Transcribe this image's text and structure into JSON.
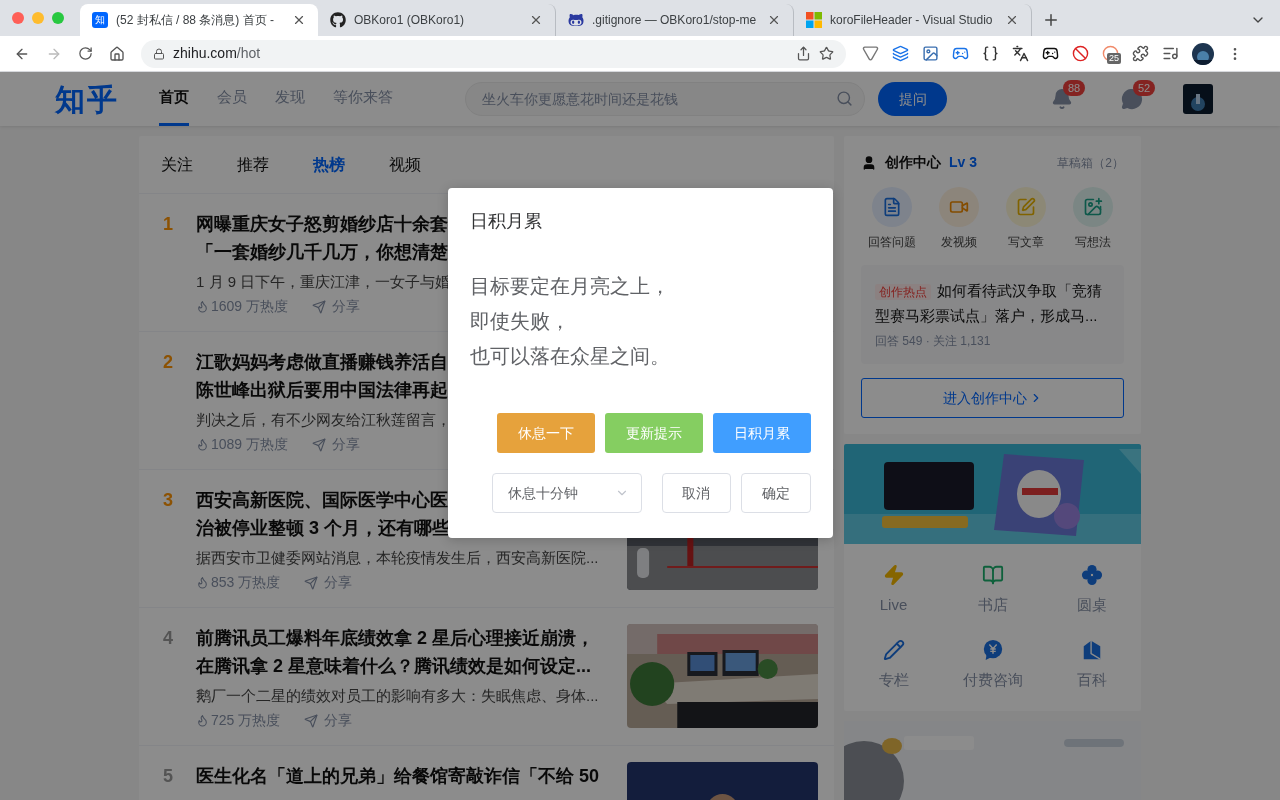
{
  "browser": {
    "tabs": [
      {
        "favicon": "知",
        "title": "(52 封私信 / 88 条消息) 首页 -",
        "selected": true
      },
      {
        "title": "OBKoro1 (OBKoro1)",
        "selected": false
      },
      {
        "title": ".gitignore — OBKoro1/stop-me",
        "selected": false
      },
      {
        "title": "koroFileHeader - Visual Studio",
        "selected": false
      }
    ],
    "url": {
      "host": "zhihu.com",
      "path": "/hot"
    },
    "extension_badge": "25"
  },
  "header": {
    "logo": "知乎",
    "nav": [
      {
        "label": "首页",
        "selected": true
      },
      {
        "label": "会员",
        "selected": false
      },
      {
        "label": "发现",
        "selected": false
      },
      {
        "label": "等你来答",
        "selected": false
      }
    ],
    "search": {
      "placeholder": "坐火车你更愿意花时间还是花钱"
    },
    "ask_button": "提问",
    "notification_badge": "88",
    "message_badge": "52"
  },
  "feed": {
    "tabs": [
      {
        "label": "关注",
        "selected": false
      },
      {
        "label": "推荐",
        "selected": false
      },
      {
        "label": "热榜",
        "selected": true
      },
      {
        "label": "视频",
        "selected": false
      }
    ],
    "items": [
      {
        "rank": "1",
        "hot": true,
        "title_lines": [
          "网曝重庆女子怒剪婚纱店十余套",
          "「一套婚纱几千几万，你想清楚"
        ],
        "excerpt": "1 月 9 日下午，重庆江津，一女子与婚",
        "heat": "1609 万热度",
        "share": "分享"
      },
      {
        "rank": "2",
        "hot": true,
        "title_lines": [
          "江歌妈妈考虑做直播赚钱养活自",
          "陈世峰出狱后要用中国法律再起"
        ],
        "excerpt": "判决之后，有不少网友给江秋莲留言，",
        "heat": "1089 万热度",
        "share": "分享"
      },
      {
        "rank": "3",
        "hot": true,
        "title_lines": [
          "西安高新医院、国际医学中心医",
          "治被停业整顿 3 个月，还有哪些"
        ],
        "excerpt": "据西安市卫健委网站消息，本轮疫情发生后，西安高新医院...",
        "heat": "853 万热度",
        "share": "分享",
        "thumbnail": {
          "kind": "picture"
        }
      },
      {
        "rank": "4",
        "hot": false,
        "title_lines": [
          "前腾讯员工爆料年底绩效拿 2 星后心理接近崩溃，",
          "在腾讯拿 2 星意味着什么？腾讯绩效是如何设定..."
        ],
        "excerpt": "鹅厂一个二星的绩效对员工的影响有多大：失眠焦虑、身体...",
        "heat": "725 万热度",
        "share": "分享",
        "thumbnail": {
          "kind": "picture"
        }
      },
      {
        "rank": "5",
        "hot": false,
        "title_lines": [
          "医生化名「道上的兄弟」给餐馆寄敲诈信「不给 50"
        ],
        "thumbnail": {
          "kind": "picture"
        }
      }
    ]
  },
  "creator": {
    "title": "创作中心",
    "level": "Lv 3",
    "drafts": "草稿箱（2）",
    "actions": [
      {
        "label": "回答问题"
      },
      {
        "label": "发视频"
      },
      {
        "label": "写文章"
      },
      {
        "label": "写想法"
      }
    ],
    "hot_topic": {
      "tag": "创作热点",
      "text": "如何看待武汉争取「竞猜型赛马彩票试点」落户，形成马...",
      "meta": "回答 549 · 关注 1,131"
    },
    "enter_button": "进入创作中心"
  },
  "promo": {
    "banner": {
      "kind": "picture"
    },
    "shortcuts": [
      {
        "label": "Live"
      },
      {
        "label": "书店"
      },
      {
        "label": "圆桌"
      },
      {
        "label": "专栏"
      },
      {
        "label": "付费咨询"
      },
      {
        "label": "百科"
      }
    ]
  },
  "ad": {
    "kind": "picture"
  },
  "dialog": {
    "title": "日积月累",
    "lines": [
      "目标要定在月亮之上，",
      "即使失败，",
      "也可以落在众星之间。"
    ],
    "color_buttons": [
      {
        "label": "休息一下",
        "color": "#e6a23c"
      },
      {
        "label": "更新提示",
        "color": "#85ce61"
      },
      {
        "label": "日积月累",
        "color": "#409eff"
      }
    ],
    "select": {
      "value": "休息十分钟"
    },
    "cancel": "取消",
    "confirm": "确定"
  }
}
